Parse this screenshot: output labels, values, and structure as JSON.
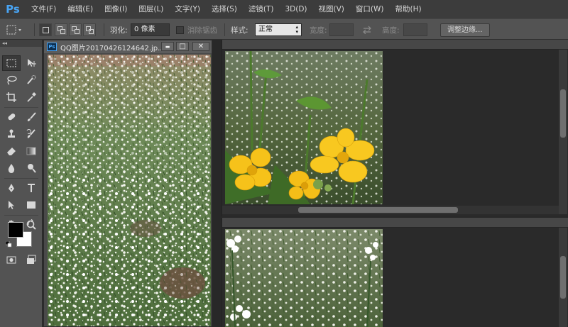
{
  "app": {
    "logo": "Ps",
    "brand_color": "#49a5f5"
  },
  "menu": [
    "文件(F)",
    "编辑(E)",
    "图像(I)",
    "图层(L)",
    "文字(Y)",
    "选择(S)",
    "滤镜(T)",
    "3D(D)",
    "视图(V)",
    "窗口(W)",
    "帮助(H)"
  ],
  "options": {
    "feather_label": "羽化:",
    "feather_value": "0 像素",
    "antialias_label": "消除锯齿",
    "style_label": "样式:",
    "style_value": "正常",
    "width_label": "宽度:",
    "height_label": "高度:",
    "refine_edge_button": "调整边缘..."
  },
  "tools": [
    "rectangular-marquee",
    "move",
    "lasso",
    "quick-selection",
    "crop",
    "eyedropper",
    "spot-healing-brush",
    "brush",
    "clone-stamp",
    "history-brush",
    "eraser",
    "gradient",
    "blur",
    "dodge",
    "pen",
    "horizontal-type",
    "path-selection",
    "rectangle",
    "hand",
    "zoom"
  ],
  "colors": {
    "foreground": "#000000",
    "background": "#ffffff"
  },
  "document": {
    "title": "QQ图片20170426124642.jp..."
  },
  "window_controls": {
    "minimize": "▬",
    "restore": "□",
    "close": "✕"
  },
  "panel_collapse": "◂◂"
}
